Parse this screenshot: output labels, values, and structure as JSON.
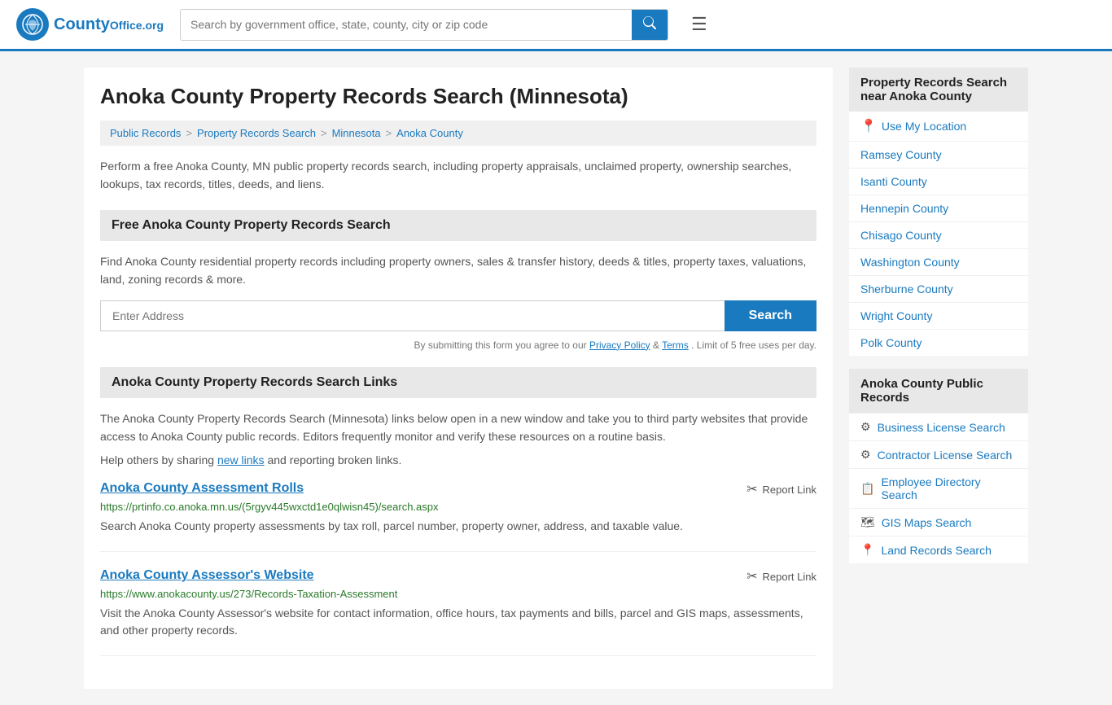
{
  "header": {
    "logo_text": "County",
    "logo_org": "Office.org",
    "search_placeholder": "Search by government office, state, county, city or zip code",
    "search_icon": "🔍"
  },
  "page": {
    "title": "Anoka County Property Records Search (Minnesota)",
    "breadcrumbs": [
      {
        "label": "Public Records",
        "href": "#"
      },
      {
        "label": "Property Records Search",
        "href": "#"
      },
      {
        "label": "Minnesota",
        "href": "#"
      },
      {
        "label": "Anoka County",
        "href": "#"
      }
    ],
    "intro": "Perform a free Anoka County, MN public property records search, including property appraisals, unclaimed property, ownership searches, lookups, tax records, titles, deeds, and liens.",
    "free_search": {
      "heading": "Free Anoka County Property Records Search",
      "desc": "Find Anoka County residential property records including property owners, sales & transfer history, deeds & titles, property taxes, valuations, land, zoning records & more.",
      "address_placeholder": "Enter Address",
      "search_button": "Search",
      "disclaimer": "By submitting this form you agree to our",
      "privacy_label": "Privacy Policy",
      "terms_label": "Terms",
      "limit_text": ". Limit of 5 free uses per day."
    },
    "links_section": {
      "heading": "Anoka County Property Records Search Links",
      "intro": "The Anoka County Property Records Search (Minnesota) links below open in a new window and take you to third party websites that provide access to Anoka County public records. Editors frequently monitor and verify these resources on a routine basis.",
      "share_text": "Help others by sharing",
      "new_links_label": "new links",
      "reporting_text": "and reporting broken links.",
      "records": [
        {
          "title": "Anoka County Assessment Rolls",
          "url": "https://prtinfo.co.anoka.mn.us/(5rgyv445wxctd1e0qlwisn45)/search.aspx",
          "desc": "Search Anoka County property assessments by tax roll, parcel number, property owner, address, and taxable value.",
          "report_label": "Report Link"
        },
        {
          "title": "Anoka County Assessor's Website",
          "url": "https://www.anokacounty.us/273/Records-Taxation-Assessment",
          "desc": "Visit the Anoka County Assessor's website for contact information, office hours, tax payments and bills, parcel and GIS maps, assessments, and other property records.",
          "report_label": "Report Link"
        }
      ]
    }
  },
  "sidebar": {
    "nearby_header": "Property Records Search near Anoka County",
    "use_location_label": "Use My Location",
    "nearby_counties": [
      {
        "label": "Ramsey County"
      },
      {
        "label": "Isanti County"
      },
      {
        "label": "Hennepin County"
      },
      {
        "label": "Chisago County"
      },
      {
        "label": "Washington County"
      },
      {
        "label": "Sherburne County"
      },
      {
        "label": "Wright County"
      },
      {
        "label": "Polk County"
      }
    ],
    "public_records_header": "Anoka County Public Records",
    "public_records_items": [
      {
        "label": "Business License Search",
        "icon": "⚙"
      },
      {
        "label": "Contractor License Search",
        "icon": "⚙"
      },
      {
        "label": "Employee Directory Search",
        "icon": "📋"
      },
      {
        "label": "GIS Maps Search",
        "icon": "🗺"
      },
      {
        "label": "Land Records Search",
        "icon": "📍"
      }
    ]
  }
}
